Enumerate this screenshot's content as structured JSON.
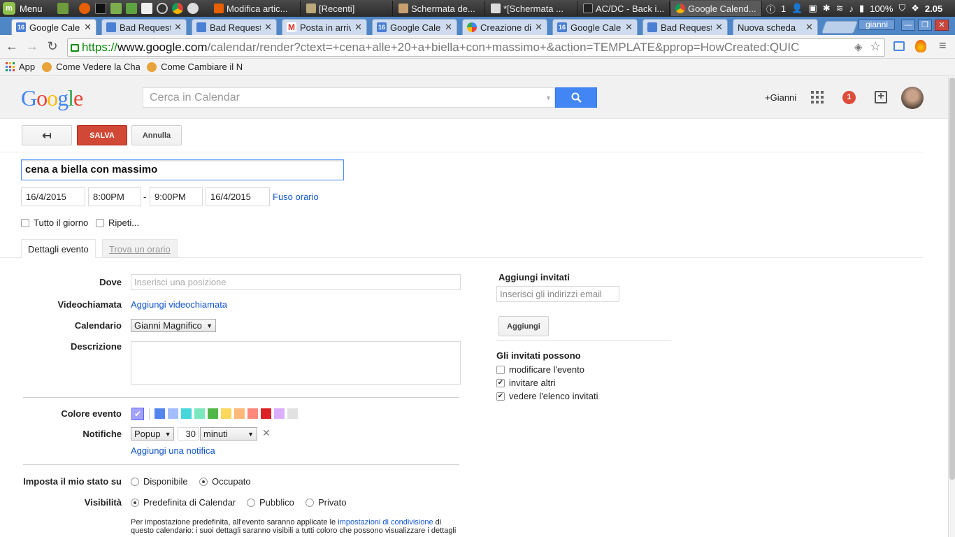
{
  "os": {
    "menu_label": "Menu",
    "tasks": [
      {
        "label": "Modifica artic..."
      },
      {
        "label": "[Recenti]"
      },
      {
        "label": "Schermata de..."
      },
      {
        "label": "*[Schermata ..."
      },
      {
        "label": "AC/DC - Back i..."
      },
      {
        "label": "Google Calend..."
      }
    ],
    "tray": {
      "count": "1",
      "battery": "100%",
      "time": "2.05"
    }
  },
  "browser": {
    "tabs": [
      {
        "label": "Google Caler",
        "active": true
      },
      {
        "label": "Bad Request"
      },
      {
        "label": "Bad Request"
      },
      {
        "label": "Posta in arriv"
      },
      {
        "label": "Google Caler"
      },
      {
        "label": "Creazione di"
      },
      {
        "label": "Google Caler"
      },
      {
        "label": "Bad Request"
      },
      {
        "label": "Nuova scheda"
      }
    ],
    "user": "gianni",
    "url": {
      "scheme": "https://",
      "host": "www.google.com",
      "path": "/calendar/render?ctext=+cena+alle+20+a+biella+con+massimo+&action=TEMPLATE&pprop=HowCreated:QUIC"
    },
    "bookmarks": [
      {
        "label": "App"
      },
      {
        "label": "Come Vedere la Cha"
      },
      {
        "label": "Come Cambiare il N"
      }
    ]
  },
  "header": {
    "search_placeholder": "Cerca in Calendar",
    "user_link": "+Gianni",
    "notification_count": "1"
  },
  "actions": {
    "save": "SALVA",
    "cancel": "Annulla"
  },
  "event": {
    "title": "cena a biella con massimo",
    "start_date": "16/4/2015",
    "start_time": "8:00PM",
    "separator": "-",
    "end_time": "9:00PM",
    "end_date": "16/4/2015",
    "timezone_link": "Fuso orario",
    "all_day_label": "Tutto il giorno",
    "repeat_label": "Ripeti..."
  },
  "tabs": {
    "details": "Dettagli evento",
    "find_time": "Trova un orario"
  },
  "details": {
    "where_label": "Dove",
    "where_placeholder": "Inserisci una posizione",
    "video_label": "Videochiamata",
    "video_link": "Aggiungi videochiamata",
    "calendar_label": "Calendario",
    "calendar_value": "Gianni Magnifico",
    "description_label": "Descrizione",
    "color_label": "Colore evento",
    "colors": [
      "#5484ed",
      "#a4bdfc",
      "#46d6db",
      "#7ae7bf",
      "#51b749",
      "#fbd75b",
      "#ffb878",
      "#ff887c",
      "#dc2127",
      "#dbadff",
      "#e1e1e1"
    ],
    "notify_label": "Notifiche",
    "notify_type": "Popup",
    "notify_amount": "30",
    "notify_unit": "minuti",
    "add_notification": "Aggiungi una notifica",
    "status_label": "Imposta il mio stato su",
    "status_available": "Disponibile",
    "status_busy": "Occupato",
    "visibility_label": "Visibilità",
    "vis_default": "Predefinita di Calendar",
    "vis_public": "Pubblico",
    "vis_private": "Privato",
    "note_prefix": "Per impostazione predefinita, all'evento saranno applicate le",
    "note_link": "impostazioni di condivisione",
    "note_suffix": "di",
    "note_line2": "questo calendario: i suoi dettagli saranno visibili a tutti coloro che possono visualizzare i dettagli"
  },
  "guests": {
    "title": "Aggiungi invitati",
    "input_placeholder": "Inserisci gli indirizzi email",
    "add_button": "Aggiungi",
    "perms_title": "Gli invitati possono",
    "perm_modify": "modificare l'evento",
    "perm_invite": "invitare altri",
    "perm_see": "vedere l'elenco invitati"
  }
}
